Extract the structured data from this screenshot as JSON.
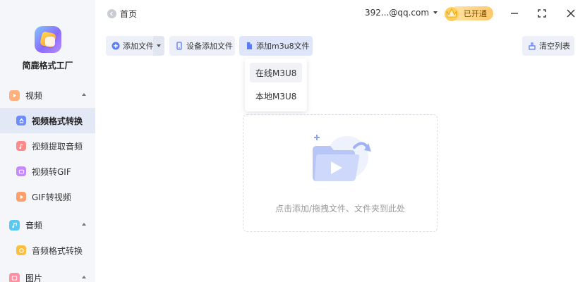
{
  "app": {
    "name": "简鹿格式工厂"
  },
  "sidebar": {
    "categories": [
      {
        "label": "视频",
        "icon": "video-icon",
        "color": "#ff9f6b"
      },
      {
        "label": "音频",
        "icon": "music-icon",
        "color": "#59c9f4"
      },
      {
        "label": "图片",
        "icon": "image-icon",
        "color": "#ff8fa3"
      }
    ],
    "video_items": [
      {
        "label": "视频格式转换",
        "icon": "video-convert-icon",
        "color": "#6b8dff"
      },
      {
        "label": "视频提取音频",
        "icon": "extract-audio-icon",
        "color": "#ff8a8a"
      },
      {
        "label": "视频转GIF",
        "icon": "gif-icon",
        "color": "#c58aff"
      },
      {
        "label": "GIF转视频",
        "icon": "gif-video-icon",
        "color": "#ff9f6b"
      }
    ],
    "audio_items": [
      {
        "label": "音频格式转换",
        "icon": "audio-convert-icon",
        "color": "#ffbf3d"
      }
    ],
    "active_item": "视频格式转换"
  },
  "header": {
    "home_label": "首页",
    "account_label": "392...@qq.com",
    "vip_label": "已开通"
  },
  "toolbar": {
    "add_file_label": "添加文件",
    "device_add_label": "设备添加文件",
    "add_m3u8_label": "添加m3u8文件",
    "clear_label": "清空列表"
  },
  "dropdown": {
    "items": [
      "在线M3U8",
      "本地M3U8"
    ]
  },
  "dropzone": {
    "hint": "点击添加/拖拽文件、文件夹到此处"
  },
  "colors": {
    "accent": "#5b7cf7",
    "sidebar_bg": "#f5f6f9",
    "active_bg": "#e3e8f7"
  }
}
